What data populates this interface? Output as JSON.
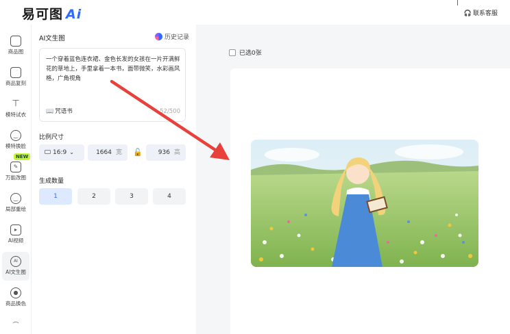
{
  "app": {
    "logo_text": "易可图",
    "logo_ai": "Ai",
    "support_label": "联系客服"
  },
  "sidebar": {
    "items": [
      {
        "label": "商品图",
        "glyph": "▭"
      },
      {
        "label": "商品复刻",
        "glyph": "▭"
      },
      {
        "label": "模特试衣",
        "glyph": "👕"
      },
      {
        "label": "模特换脸",
        "glyph": "☺"
      },
      {
        "label": "万能改图",
        "glyph": "✎"
      },
      {
        "label": "局部重绘",
        "glyph": "☺"
      },
      {
        "label": "AI视频",
        "glyph": "▶"
      },
      {
        "label": "AI文生图",
        "glyph": "AI"
      },
      {
        "label": "商品换色",
        "glyph": "◐"
      }
    ],
    "new_badge": "NEW"
  },
  "panel": {
    "title": "AI文生图",
    "history_label": "历史记录",
    "prompt_text": "一个穿着蓝色连衣裙、金色长发的女孩在一片开满鲜花的草地上，手里拿着一本书，面带微笑，水彩画风格，广角视角",
    "spellbook_label": "咒语书",
    "char_counter": "52/500",
    "ratio_section_label": "比例尺寸",
    "ratio_value": "16:9",
    "width_value": "1664",
    "width_unit": "宽",
    "height_value": "936",
    "height_unit": "高",
    "quantity_section_label": "生成数量",
    "quantity_options": [
      "1",
      "2",
      "3",
      "4"
    ],
    "quantity_selected": "1"
  },
  "workspace": {
    "selected_label": "已选0张"
  },
  "colors": {
    "accent": "#2f6bff",
    "arrow": "#e8413b",
    "selected_bg": "#dce9ff",
    "new_badge": "#c7f33d"
  }
}
